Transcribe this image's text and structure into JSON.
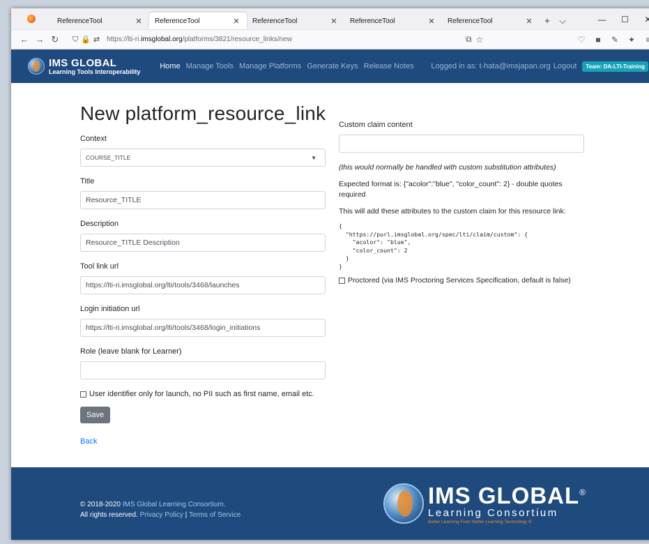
{
  "browser": {
    "tabs": [
      {
        "label": "ReferenceTool",
        "close": "✕"
      },
      {
        "label": "ReferenceTool",
        "close": "✕"
      },
      {
        "label": "ReferenceTool",
        "close": "✕"
      },
      {
        "label": "ReferenceTool",
        "close": "✕"
      },
      {
        "label": "ReferenceTool",
        "close": "✕"
      }
    ],
    "new_tab": "+",
    "tab_list": "⌵",
    "window": {
      "minimize": "—",
      "maximize": "☐",
      "close": "✕"
    },
    "url_prefix": "https://lti-ri.",
    "url_domain": "imsglobal.org",
    "url_path": "/platforms/3821/resource_links/new"
  },
  "navbar": {
    "brand_line1": "IMS GLOBAL",
    "brand_line2": "Learning Tools Interoperability",
    "links": [
      "Home",
      "Manage Tools",
      "Manage Platforms",
      "Generate Keys",
      "Release Notes"
    ],
    "logged_in": "Logged in as: t-hata@imsjapan.org",
    "logout": "Logout",
    "team_badge": "Team: DA-LTI-Training"
  },
  "page": {
    "title": "New platform_resource_link"
  },
  "form": {
    "context_label": "Context",
    "context_value": "COURSE_TITLE",
    "title_label": "Title",
    "title_value": "Resource_TITLE",
    "description_label": "Description",
    "description_value": "Resource_TITLE Description",
    "tool_link_label": "Tool link url",
    "tool_link_value": "https://lti-ri.imsglobal.org/lti/tools/3468/launches",
    "login_label": "Login initiation url",
    "login_value": "https://lti-ri.imsglobal.org/lti/tools/3468/login_initiations",
    "role_label": "Role (leave blank for Learner)",
    "role_value": "",
    "user_identifier_label": "User identifier only for launch, no PII such as first name, email etc.",
    "save_label": "Save",
    "back_label": "Back"
  },
  "custom": {
    "label": "Custom claim content",
    "value": "",
    "note": "(this would normally be handled with custom substitution attributes)",
    "expected": "Expected format is: {\"acolor\":\"blue\", \"color_count\": 2} - double quotes required",
    "will_add": "This will add these attributes to the custom claim for this resource link:",
    "json_example": "{\n  \"https://purl.imsglobal.org/spec/lti/claim/custom\": {\n    \"acolor\": \"blue\",\n    \"color_count\": 2\n  }\n}",
    "proctored_label": "Proctored (via IMS Proctoring Services Specification, default is false)"
  },
  "footer": {
    "copyright_prefix": "© 2018-2020 ",
    "copyright_link": "IMS Global Learning Consortium.",
    "rights": "All rights reserved.",
    "privacy": "Privacy Policy",
    "separator": " | ",
    "terms": "Terms of Service",
    "logo_line1": "IMS GLOBAL",
    "logo_reg": "®",
    "logo_line2": "Learning Consortium",
    "logo_tagline": "Better Learning From Better Learning Technology ®"
  }
}
